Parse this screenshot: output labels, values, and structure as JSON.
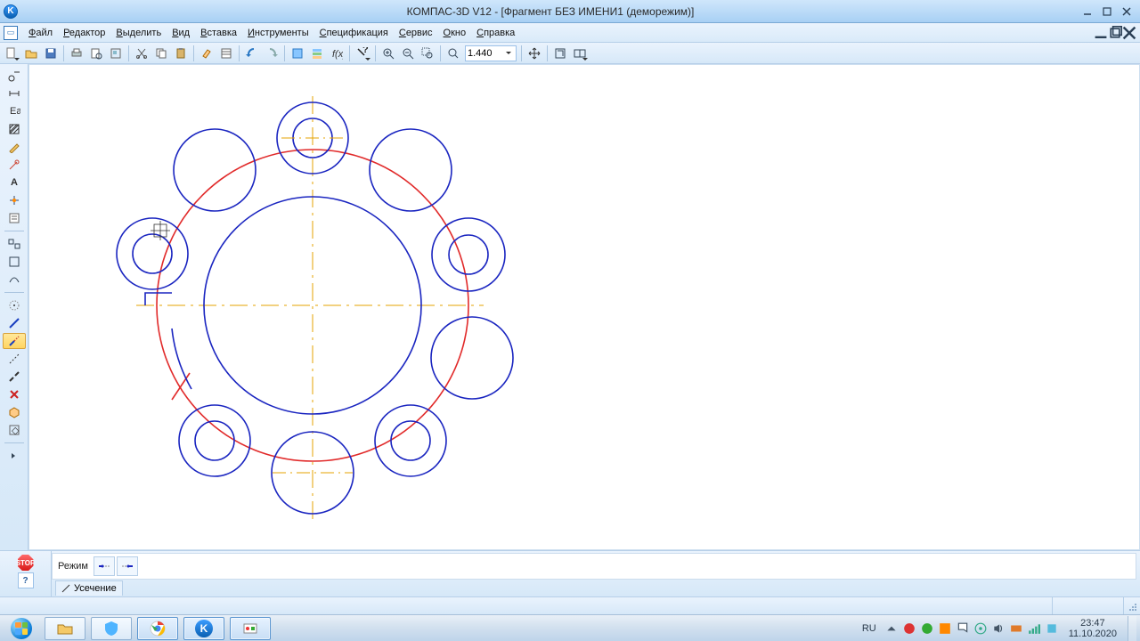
{
  "titlebar": {
    "title": "КОМПАС-3D V12 - [Фрагмент БЕЗ ИМЕНИ1 (деморежим)]",
    "app_icon_letter": "K"
  },
  "menu": {
    "items": [
      "Файл",
      "Редактор",
      "Выделить",
      "Вид",
      "Вставка",
      "Инструменты",
      "Спецификация",
      "Сервис",
      "Окно",
      "Справка"
    ]
  },
  "toolbar": {
    "zoom_value": "1.440"
  },
  "property_panel": {
    "stop_label": "STOP",
    "help_label": "?",
    "mode_label": "Режим",
    "tab_label": "Усечение"
  },
  "taskbar": {
    "lang": "RU",
    "clock_time": "23:47",
    "clock_date": "11.10.2020"
  }
}
